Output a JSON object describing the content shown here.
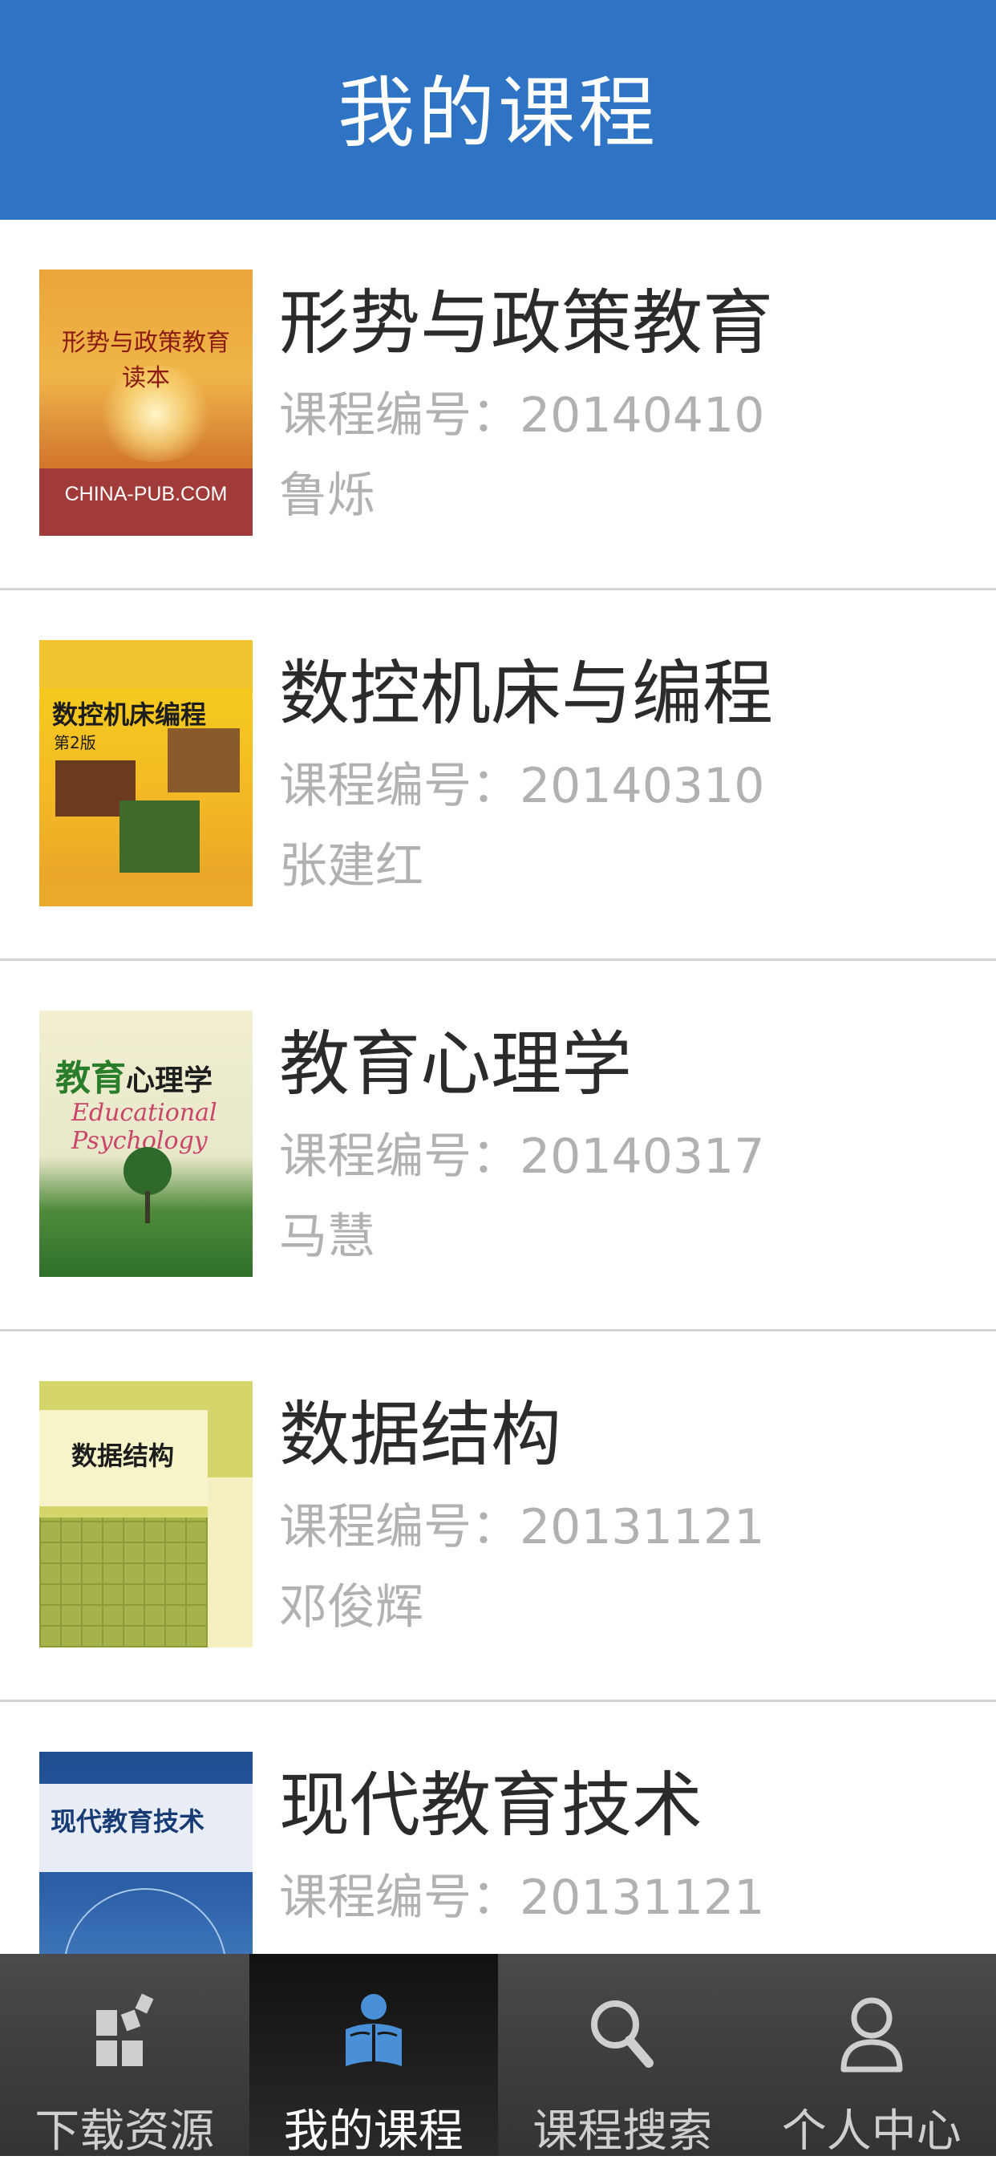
{
  "header": {
    "title": "我的课程"
  },
  "courses": [
    {
      "title": "形势与政策教育",
      "code": "课程编号：20140410",
      "teacher": "鲁烁",
      "cover": {
        "text": "形势与政策教育读本",
        "publisher": "CHINA-PUB.COM"
      }
    },
    {
      "title": "数控机床与编程",
      "code": "课程编号：20140310",
      "teacher": "张建红",
      "cover": {
        "text": "数控机床编程",
        "edition": "第2版"
      }
    },
    {
      "title": "教育心理学",
      "code": "课程编号：20140317",
      "teacher": "马慧",
      "cover": {
        "text_a": "教育",
        "text_b": "心理学",
        "script": "Educational Psychology"
      }
    },
    {
      "title": "数据结构",
      "code": "课程编号：20131121",
      "teacher": "邓俊辉",
      "cover": {
        "text": "数据结构"
      }
    },
    {
      "title": "现代教育技术",
      "code": "课程编号：20131121",
      "teacher": "",
      "cover": {
        "text": "现代教育技术"
      }
    }
  ],
  "tabbar": {
    "active": 1,
    "items": [
      {
        "label": "下载资源",
        "icon": "download-blocks-icon"
      },
      {
        "label": "我的课程",
        "icon": "reading-person-icon"
      },
      {
        "label": "课程搜索",
        "icon": "search-icon"
      },
      {
        "label": "个人中心",
        "icon": "person-icon"
      }
    ]
  },
  "colors": {
    "header": "#2f74c4",
    "title_text": "#2b2b2b",
    "meta_text": "#b1b1b1",
    "active_icon": "#4a90d9"
  }
}
